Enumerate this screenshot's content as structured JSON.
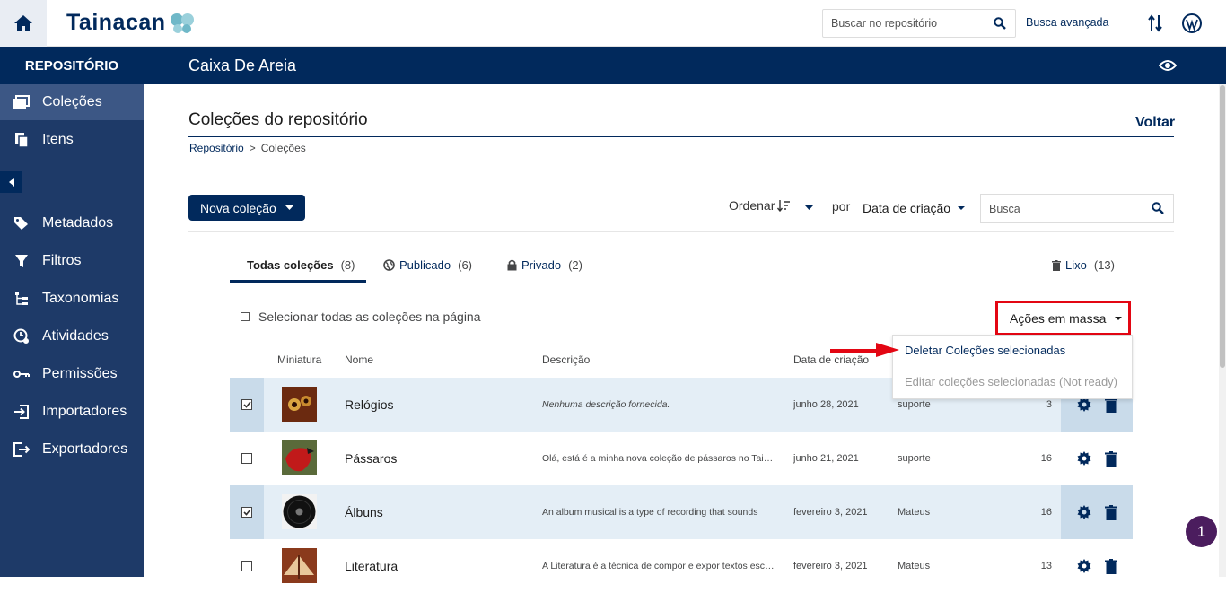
{
  "header": {
    "logo_text": "Tainacan",
    "search_placeholder": "Buscar no repositório",
    "advanced_search": "Busca avançada"
  },
  "subheader": {
    "repository_label": "REPOSITÓRIO",
    "site_title": "Caixa De Areia"
  },
  "sidebar": {
    "items": [
      {
        "label": "Coleções",
        "icon": "collections-icon",
        "active": true
      },
      {
        "label": "Itens",
        "icon": "items-icon"
      },
      {
        "label": "Metadados",
        "icon": "tags-icon"
      },
      {
        "label": "Filtros",
        "icon": "filter-icon"
      },
      {
        "label": "Taxonomias",
        "icon": "taxonomy-icon"
      },
      {
        "label": "Atividades",
        "icon": "activities-icon"
      },
      {
        "label": "Permissões",
        "icon": "key-icon"
      },
      {
        "label": "Importadores",
        "icon": "import-icon"
      },
      {
        "label": "Exportadores",
        "icon": "export-icon"
      }
    ]
  },
  "page": {
    "title": "Coleções do repositório",
    "back": "Voltar",
    "breadcrumb": [
      "Repositório",
      "Coleções"
    ],
    "breadcrumb_sep": ">"
  },
  "controls": {
    "new_collection": "Nova coleção",
    "order_label": "Ordenar",
    "by_label": "por",
    "sort_field": "Data de criação",
    "search_placeholder": "Busca"
  },
  "tabs": [
    {
      "label": "Todas coleções",
      "count": "(8)",
      "active": true
    },
    {
      "label": "Publicado",
      "count": "(6)",
      "icon": "globe-icon"
    },
    {
      "label": "Privado",
      "count": "(2)",
      "icon": "lock-icon"
    },
    {
      "label": "Lixo",
      "count": "(13)",
      "icon": "trash-icon"
    }
  ],
  "bulk": {
    "select_all": "Selecionar todas as coleções na página",
    "button": "Ações em massa",
    "menu": [
      "Deletar Coleções selecionadas",
      "Editar coleções selecionadas (Not ready)"
    ]
  },
  "table": {
    "headers": [
      "Miniatura",
      "Nome",
      "Descrição",
      "Data de criação"
    ],
    "rows": [
      {
        "name": "Relógios",
        "description": "Nenhuma descrição fornecida.",
        "date": "junho 28, 2021",
        "author": "suporte",
        "count": "3",
        "selected": true,
        "thumb_color": "#6b2a10"
      },
      {
        "name": "Pássaros",
        "description": "Olá, está é a minha nova coleção de pássaros no Tainacan",
        "date": "junho 21, 2021",
        "author": "suporte",
        "count": "16",
        "selected": false,
        "thumb_color": "#c11a1a"
      },
      {
        "name": "Álbuns",
        "description": "An album musical is a type of recording that sounds",
        "date": "fevereiro 3, 2021",
        "author": "Mateus",
        "count": "16",
        "selected": true,
        "thumb_color": "#111111"
      },
      {
        "name": "Literatura",
        "description": "A Literatura é a técnica de compor e expor textos escritos",
        "date": "fevereiro 3, 2021",
        "author": "Mateus",
        "count": "13",
        "selected": false,
        "thumb_color": "#8a3a1c"
      }
    ]
  },
  "notification_count": "1"
}
